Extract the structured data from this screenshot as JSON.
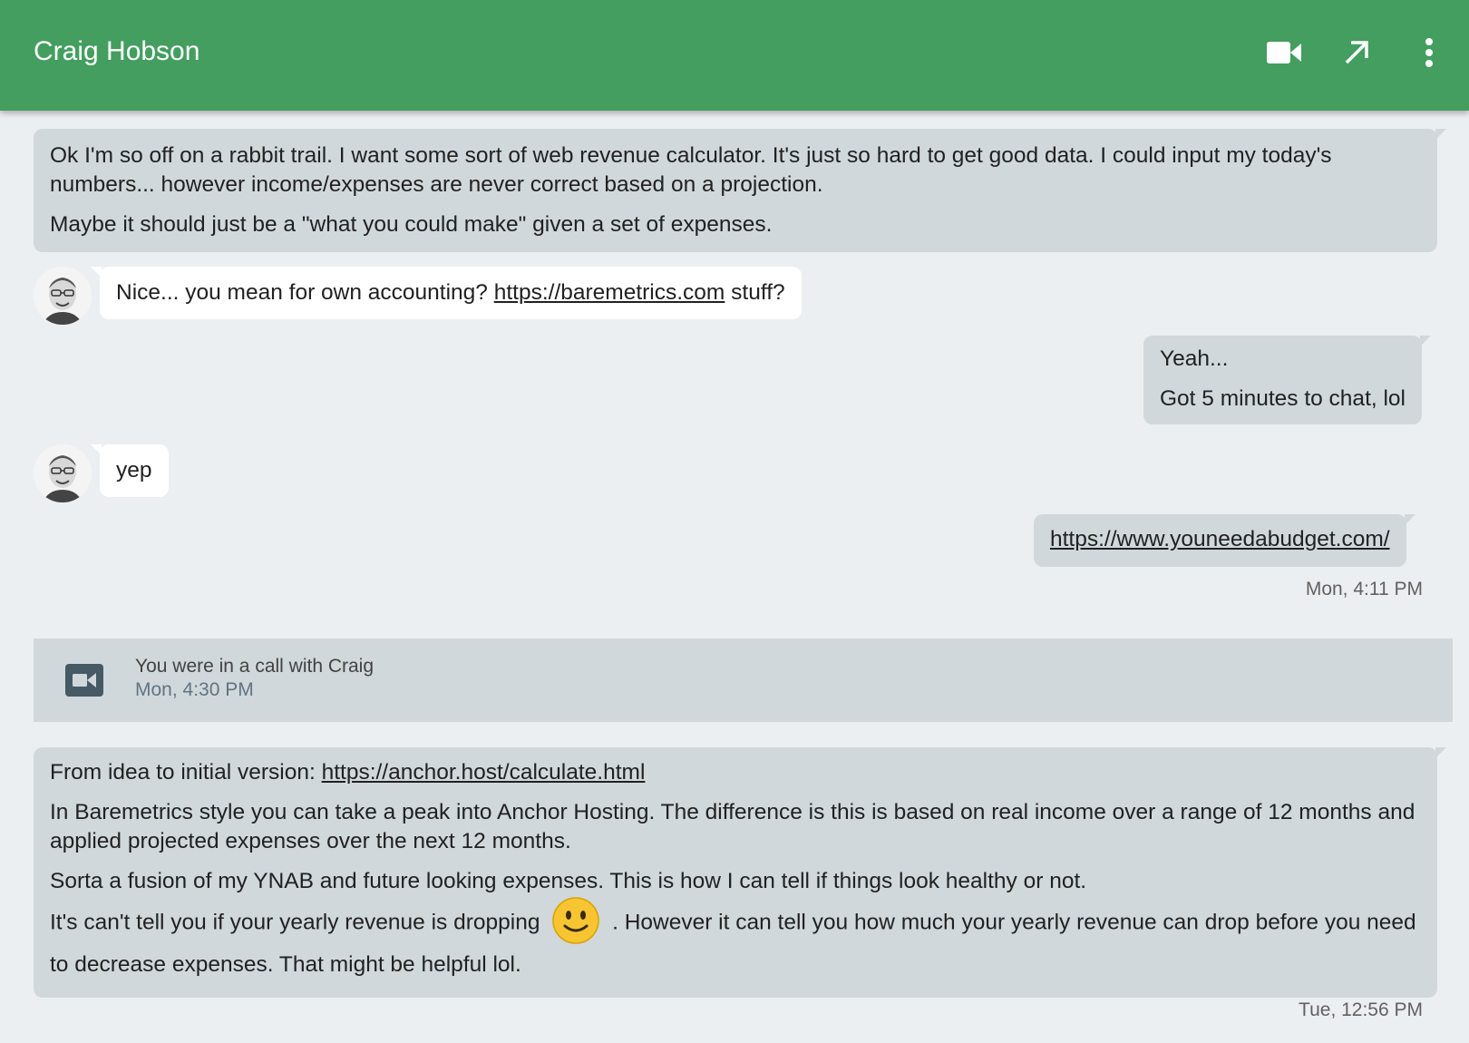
{
  "header": {
    "title": "Craig Hobson",
    "icons": [
      "video-call-icon",
      "open-in-new-window-icon",
      "more-options-icon"
    ],
    "color": "#439e5f"
  },
  "messages": {
    "m1": {
      "p1": "Ok I'm so off on a rabbit trail. I want some sort of web revenue calculator. It's just so hard to get good data. I could input my today's numbers... however income/expenses are never correct based on a projection.",
      "p2": "Maybe it should just be a \"what you could make\" given a set of expenses."
    },
    "m2": {
      "before": "Nice... you mean for own accounting? ",
      "link": "https://baremetrics.com",
      "after": " stuff?"
    },
    "m3": {
      "p1": "Yeah...",
      "p2": "Got 5 minutes to chat, lol"
    },
    "m4": {
      "text": "yep"
    },
    "m5": {
      "link": "https://www.youneedabudget.com/"
    },
    "time1": "Mon, 4:11 PM",
    "call": {
      "title": "You were in a call with Craig",
      "time": "Mon, 4:30 PM"
    },
    "m6": {
      "p1_prefix": "From idea to initial version: ",
      "p1_link": "https://anchor.host/calculate.html",
      "p2": "In Baremetrics style you can take a peak into Anchor Hosting. The difference is this is based on real income over a range of 12 months and applied projected expenses over the next 12 months.",
      "p3": "Sorta a fusion of my YNAB and future looking expenses. This is how I can tell if things look healthy or not.",
      "p4_before": "It's can't tell you if your yearly revenue is dropping ",
      "p4_after": " . However it can tell you how much your yearly revenue can drop before you need to decrease expenses. That might be helpful lol."
    },
    "time2": "Tue, 12:56 PM"
  },
  "colors": {
    "self_bubble": "#d0d8dc",
    "other_bubble": "#ffffff",
    "background": "#eceff1"
  }
}
